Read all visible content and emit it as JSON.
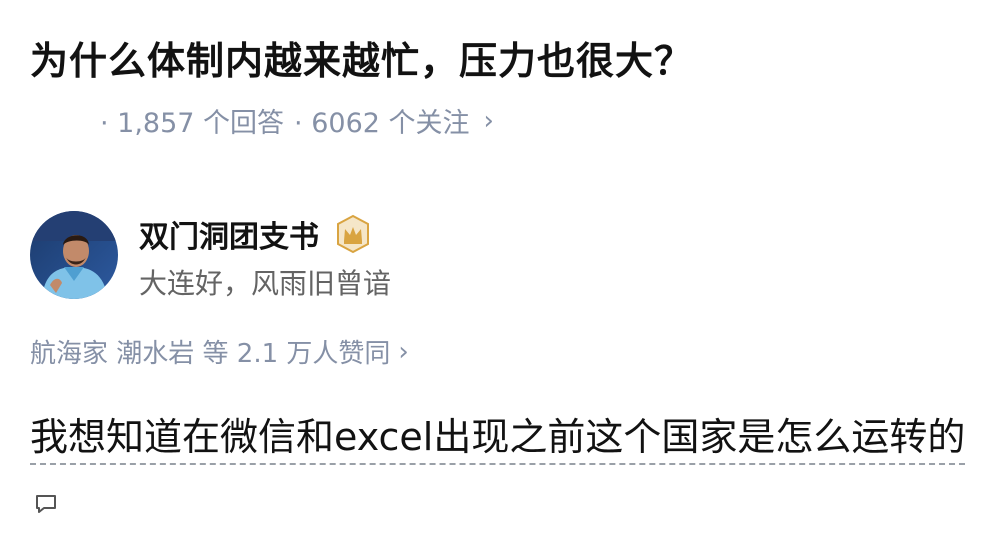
{
  "question": {
    "title": "为什么体制内越来越忙，压力也很大？",
    "answers_count": "· 1,857 个回答",
    "followers_count": "· 6062 个关注",
    "chevron": "›"
  },
  "author": {
    "name": "双门洞团支书",
    "badge_icon": "crown-badge-icon",
    "bio": "大连好，风雨旧曾谙",
    "avatar_icon": "avatar-photo"
  },
  "voteup": {
    "text": "航海家 潮水岩 等 2.1 万人赞同",
    "chevron": "›"
  },
  "answer": {
    "text": "我想知道在微信和excel出现之前这个国家是怎么运转的",
    "comment_icon": "comment-bubble-icon"
  },
  "colors": {
    "primary_text": "#121212",
    "secondary_text": "#8590a6",
    "badge_gold": "#d9a441"
  }
}
